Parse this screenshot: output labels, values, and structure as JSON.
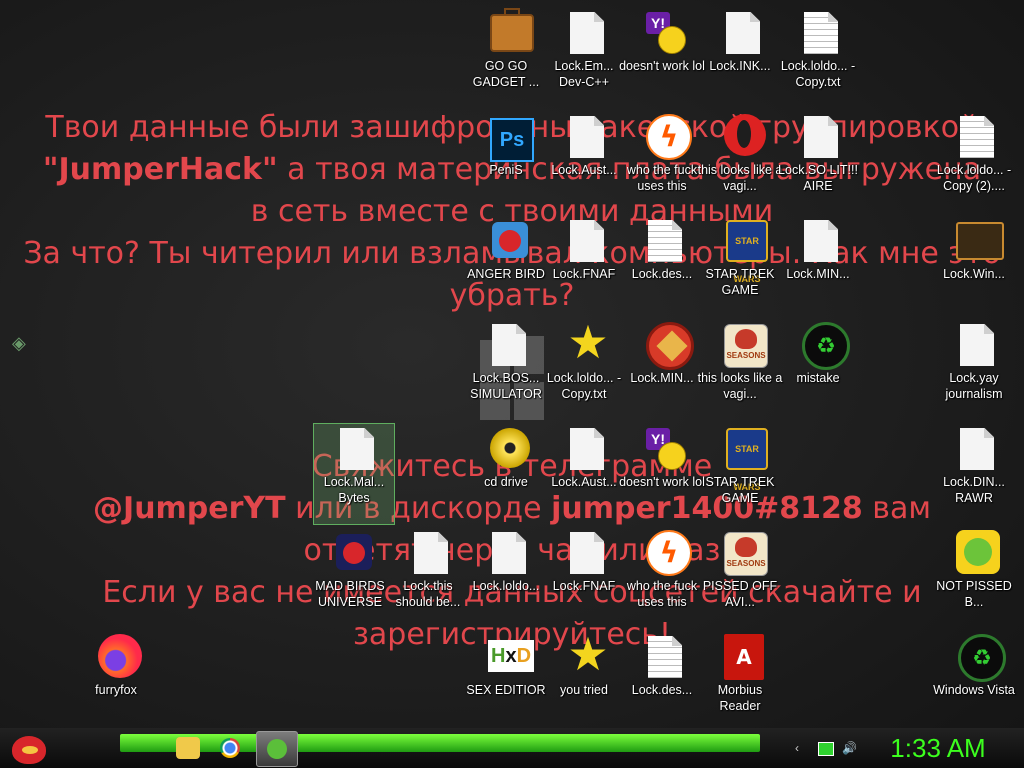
{
  "ransom_note": {
    "top_line1": "Твои данные были зашифрованы хакерской группировкой",
    "top_line2_bold": "\"JumperHack\"",
    "top_line2_rest": " а твоя материнская плата была выгружена",
    "top_line3": "в сеть вместе с твоими данными",
    "top_line4": "За что? Ты читерил или взламывал компьютеры. Как мне это",
    "top_line5": "убрать?",
    "bottom_line1": "Свяжитесь в телеграмме",
    "bottom_line2_bold1": "@JumperYT",
    "bottom_line2_mid": " или в дискорде ",
    "bottom_line2_bold2": "jumper1400#8128",
    "bottom_line2_end": " вам",
    "bottom_line3": "ответят через час или раз",
    "bottom_line4": "Если у вас не имеется данных соцсетей скачайте и",
    "bottom_line5": "зарегистрируйтесь!"
  },
  "desktop_icons": [
    {
      "label": "GO GO GADGET ...",
      "icon": "briefcase-icon"
    },
    {
      "label": "Lock.Em... Dev-C++",
      "icon": "document-icon"
    },
    {
      "label": "doesn't work lol",
      "icon": "yahoo-messenger-icon"
    },
    {
      "label": "Lock.INK...",
      "icon": "document-icon"
    },
    {
      "label": "Lock.loldo... - Copy.txt",
      "icon": "text-document-icon"
    },
    {
      "label": "PeniS",
      "icon": "photoshop-icon"
    },
    {
      "label": "Lock.Aust...",
      "icon": "document-icon"
    },
    {
      "label": "who the fuck uses this",
      "icon": "avast-icon"
    },
    {
      "label": "this looks like a vagi...",
      "icon": "opera-icon"
    },
    {
      "label": "Lock.SO LIT!!! AIRE",
      "icon": "document-icon"
    },
    {
      "label": "Lock.loldo... - Copy (2)....",
      "icon": "text-document-icon"
    },
    {
      "label": "ANGER BIRD",
      "icon": "angry-birds-icon"
    },
    {
      "label": "Lock.FNAF",
      "icon": "document-icon"
    },
    {
      "label": "Lock.des...",
      "icon": "text-document-icon"
    },
    {
      "label": "STAR TREK GAME",
      "icon": "star-wars-game-icon"
    },
    {
      "label": "Lock.MIN...",
      "icon": "document-icon"
    },
    {
      "label": "Lock.Win...",
      "icon": "folder-icon"
    },
    {
      "label": "Lock.BOS... SIMULATOR",
      "icon": "document-icon"
    },
    {
      "label": "Lock.loldo... - Copy.txt",
      "icon": "star-icon"
    },
    {
      "label": "Lock.MIN...",
      "icon": "ccleaner-icon"
    },
    {
      "label": "this looks like a vagi...",
      "icon": "angry-birds-seasons-icon"
    },
    {
      "label": "mistake",
      "icon": "recycle-icon"
    },
    {
      "label": "Lock.yay journalism",
      "icon": "document-icon"
    },
    {
      "label": "Lock.Mal... Bytes",
      "icon": "document-icon"
    },
    {
      "label": "cd drive",
      "icon": "cd-drive-icon"
    },
    {
      "label": "Lock.Aust...",
      "icon": "document-icon"
    },
    {
      "label": "doesn't work lol",
      "icon": "yahoo-messenger-icon"
    },
    {
      "label": "STAR TREK GAME",
      "icon": "star-wars-game-icon"
    },
    {
      "label": "Lock.DIN... RAWR",
      "icon": "document-icon"
    },
    {
      "label": "MAD BIRDS UNIVERSE",
      "icon": "angry-birds-space-icon"
    },
    {
      "label": "Lock.this should be...",
      "icon": "document-icon"
    },
    {
      "label": "Lock.loldo...",
      "icon": "document-icon"
    },
    {
      "label": "Lock.FNAF",
      "icon": "document-icon"
    },
    {
      "label": "who the fuck uses this",
      "icon": "avast-icon"
    },
    {
      "label": "PISSED OFF AVI...",
      "icon": "angry-birds-seasons-icon"
    },
    {
      "label": "NOT PISSED B...",
      "icon": "bad-piggies-icon"
    },
    {
      "label": "furryfox",
      "icon": "firefox-icon"
    },
    {
      "label": "SEX EDITIOR",
      "icon": "hxd-icon"
    },
    {
      "label": "you tried",
      "icon": "star-icon"
    },
    {
      "label": "Lock.des...",
      "icon": "text-document-icon"
    },
    {
      "label": "Morbius Reader",
      "icon": "pdf-reader-icon"
    },
    {
      "label": "Windows Vista",
      "icon": "recycle-bin-icon"
    }
  ],
  "icon_glyphs": {
    "yahoo": "Y!",
    "photoshop": "Ps",
    "avast": "ϟ",
    "star": "★",
    "star_wars": "STAR WARS",
    "seasons": "SEASONS",
    "recycle": "♻",
    "pdf": "A",
    "hxd_h": "H",
    "hxd_x": "x",
    "hxd_d": "D"
  },
  "taskbar": {
    "clock": "1:33 AM",
    "pinned": [
      "file-explorer-icon",
      "chrome-icon",
      "active-window-icon"
    ],
    "tray": [
      "chevron-icon",
      "network-icon",
      "volume-icon"
    ]
  },
  "colors": {
    "ransom_text": "#e2474c",
    "clock": "#3cff1e",
    "taskbar_glow": "#4ee22a"
  }
}
